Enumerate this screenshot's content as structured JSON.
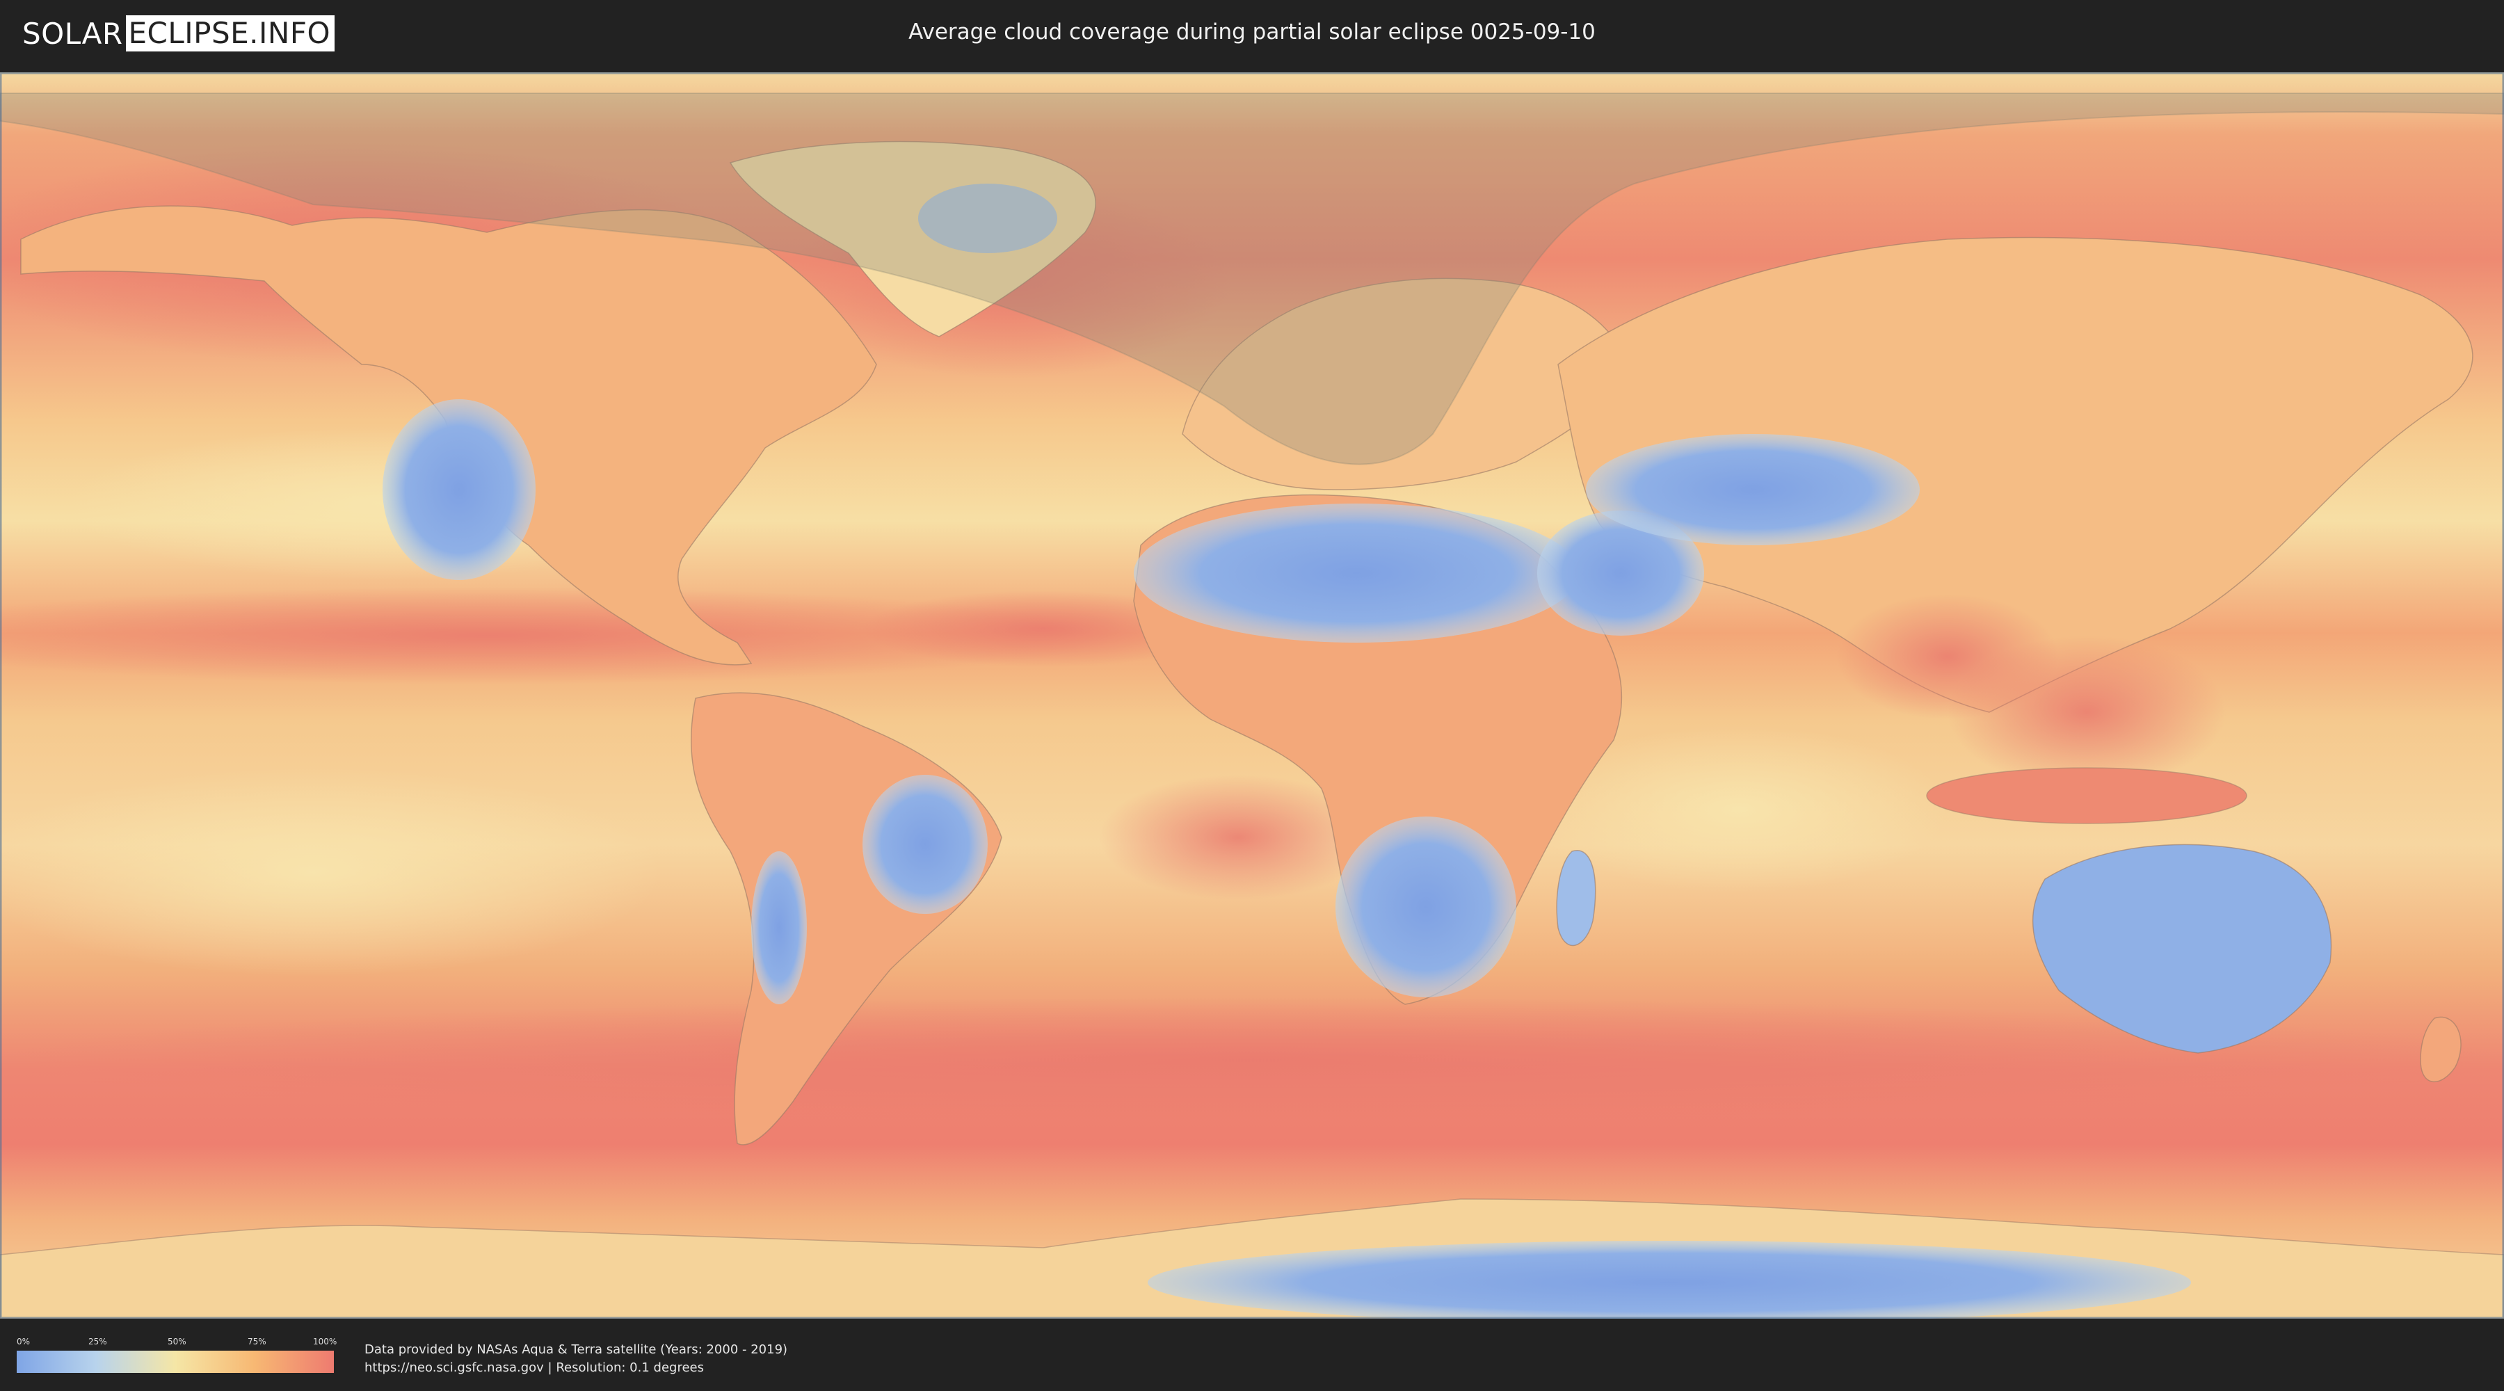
{
  "header": {
    "logo_left": "SOLAR",
    "logo_right": "ECLIPSE.INFO",
    "title": "Average cloud coverage during partial solar eclipse 0025-09-10"
  },
  "map": {
    "layer": "average-cloud-coverage",
    "colors": {
      "clear": "#7fa5e6",
      "low": "#b8d3ec",
      "mid": "#f5e6a6",
      "high": "#f7b873",
      "overcast": "#ee7b70",
      "eclipse_shadow": "#8a8a7a"
    }
  },
  "legend": {
    "ticks": [
      "0%",
      "25%",
      "50%",
      "75%",
      "100%"
    ],
    "gradient": [
      "#7fa5e6",
      "#b8d3ec",
      "#f5e6a6",
      "#f7b873",
      "#ee7b70"
    ]
  },
  "footer": {
    "line1": "Data provided by NASAs Aqua & Terra satellite (Years: 2000 - 2019)",
    "line2": "https://neo.sci.gsfc.nasa.gov | Resolution: 0.1 degrees"
  }
}
